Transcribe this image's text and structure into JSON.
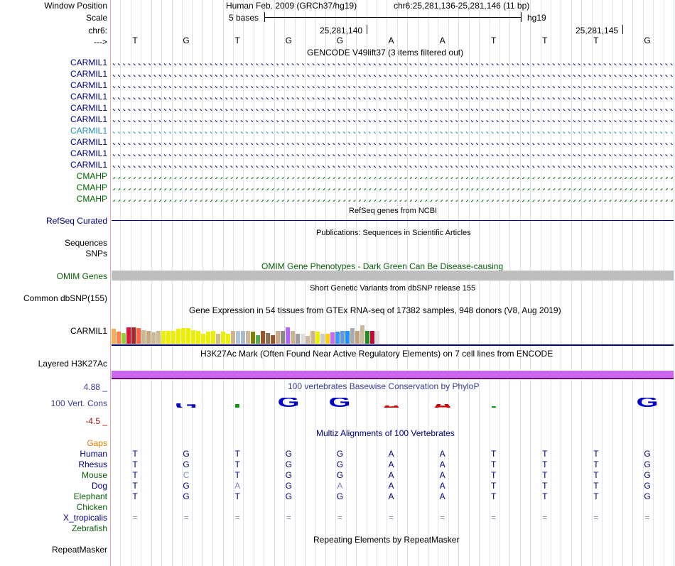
{
  "header": {
    "window_position_label": "Window Position",
    "scale_label": "Scale",
    "chrom_label": "chr6:",
    "strand_label": "--->",
    "assembly": "Human Feb. 2009 (GRCh37/hg19)",
    "position": "chr6:25,281,136-25,281,146 (11 bp)",
    "scale_text": "5 bases",
    "db": "hg19",
    "tick1": "25,281,140",
    "tick2": "25,281,145"
  },
  "sequence": [
    "T",
    "G",
    "T",
    "G",
    "G",
    "A",
    "A",
    "T",
    "T",
    "T",
    "G"
  ],
  "gencode": {
    "title": "GENCODE V49lift37 (3 items filtered out)",
    "tracks": [
      {
        "name": "CARMIL1",
        "color": "#000080",
        "dir": "right"
      },
      {
        "name": "CARMIL1",
        "color": "#000080",
        "dir": "right"
      },
      {
        "name": "CARMIL1",
        "color": "#000080",
        "dir": "right"
      },
      {
        "name": "CARMIL1",
        "color": "#000080",
        "dir": "right"
      },
      {
        "name": "CARMIL1",
        "color": "#000080",
        "dir": "right"
      },
      {
        "name": "CARMIL1",
        "color": "#000080",
        "dir": "right"
      },
      {
        "name": "CARMIL1",
        "color": "#1f8eb0",
        "dir": "right"
      },
      {
        "name": "CARMIL1",
        "color": "#000080",
        "dir": "right"
      },
      {
        "name": "CARMIL1",
        "color": "#000080",
        "dir": "right"
      },
      {
        "name": "CARMIL1",
        "color": "#000080",
        "dir": "right"
      },
      {
        "name": "CMAHP",
        "color": "#006400",
        "dir": "left"
      },
      {
        "name": "CMAHP",
        "color": "#006400",
        "dir": "left"
      },
      {
        "name": "CMAHP",
        "color": "#006400",
        "dir": "left"
      }
    ]
  },
  "refseq": {
    "title": "RefSeq genes from NCBI",
    "label": "RefSeq Curated"
  },
  "publications": {
    "title": "Publications: Sequences in Scientific Articles",
    "label1": "Sequences",
    "label2": "SNPs"
  },
  "omim": {
    "title": "OMIM Gene Phenotypes - Dark Green Can Be Disease-causing",
    "label": "OMIM Genes"
  },
  "dbsnp": {
    "title": "Short Genetic Variants from dbSNP release 155",
    "label": "Common dbSNP(155)"
  },
  "gtex": {
    "title": "Gene Expression in 54 tissues from GTEx RNA-seq of 17382 samples, 948 donors (V8, Aug 2019)",
    "label": "CARMIL1",
    "levels": [
      0.52,
      0.42,
      0.38,
      0.58,
      0.58,
      0.56,
      0.48,
      0.44,
      0.4,
      0.45,
      0.45,
      0.45,
      0.45,
      0.52,
      0.56,
      0.56,
      0.48,
      0.46,
      0.36,
      0.42,
      0.46,
      0.36,
      0.42,
      0.36,
      0.44,
      0.44,
      0.44,
      0.44,
      0.42,
      0.3,
      0.46,
      0.38,
      0.3,
      0.44,
      0.44,
      0.58,
      0.44,
      0.36,
      0.34,
      0.28,
      0.44,
      0.42,
      0.36,
      0.36,
      0.4,
      0.42,
      0.45,
      0.45,
      0.56,
      0.44,
      0.64,
      0.44,
      0.44,
      0.46
    ],
    "colors": [
      "#ffaa55",
      "#ff7f50",
      "#9acd32",
      "#dc143c",
      "#b22222",
      "#ff6347",
      "#d2b48c",
      "#c8a880",
      "#d2b48c",
      "#ccbb99",
      "#eeee00",
      "#eeee00",
      "#eeee00",
      "#eeee00",
      "#eeee00",
      "#eeee00",
      "#eeee00",
      "#eeee00",
      "#eeee00",
      "#eeee00",
      "#eeee00",
      "#ccbb99",
      "#eeee00",
      "#eeee00",
      "#d2b48c",
      "#b0c4de",
      "#aabbcc",
      "#cdb79e",
      "#808000",
      "#55aa55",
      "#a0522d",
      "#8b7355",
      "#a0522d",
      "#ccaa88",
      "#8b8b83",
      "#b266ff",
      "#cdb38b",
      "#a0a0a0",
      "#dddddd",
      "#cdb79e",
      "#d2b48c",
      "#eeee00",
      "#cccccc",
      "#ffcc00",
      "#cc66ff",
      "#3399ff",
      "#6495ed",
      "#1e90ff",
      "#aaaaaa",
      "#c0a080",
      "#ccbb99",
      "#228b22",
      "#cc0033",
      "#dddddd"
    ]
  },
  "h3k27ac": {
    "title": "H3K27Ac Mark (Often Found Near Active Regulatory Elements) on 7 cell lines from ENCODE",
    "label": "Layered H3K27Ac"
  },
  "cons": {
    "title": "100 vertebrates Basewise Conservation by PhyloP",
    "label": "100 Vert. Cons",
    "ymax": "4.88 _",
    "ymin": "-4.5 _",
    "scores": [
      0,
      0.4,
      0.3,
      0.9,
      0.9,
      0.2,
      0.3,
      0.05,
      0,
      0,
      0.9
    ]
  },
  "multiz": {
    "title": "Multiz Alignments of 100 Vertebrates",
    "gaps_label": "Gaps",
    "species": [
      {
        "name": "Human",
        "color": "#000080",
        "bases": [
          "T",
          "G",
          "T",
          "G",
          "G",
          "A",
          "A",
          "T",
          "T",
          "T",
          "G"
        ]
      },
      {
        "name": "Rhesus",
        "color": "#000080",
        "bases": [
          "T",
          "G",
          "T",
          "G",
          "G",
          "A",
          "A",
          "T",
          "T",
          "T",
          "G"
        ]
      },
      {
        "name": "Mouse",
        "color": "#0b5e0b",
        "bases": [
          "T",
          "C",
          "T",
          "G",
          "G",
          "A",
          "A",
          "T",
          "T",
          "T",
          "G"
        ]
      },
      {
        "name": "Dog",
        "color": "#000080",
        "bases": [
          "T",
          "G",
          "A",
          "G",
          "A",
          "A",
          "A",
          "T",
          "T",
          "T",
          "G"
        ]
      },
      {
        "name": "Elephant",
        "color": "#0b5e0b",
        "bases": [
          "T",
          "G",
          "T",
          "G",
          "G",
          "A",
          "A",
          "T",
          "T",
          "T",
          "G"
        ]
      },
      {
        "name": "Chicken",
        "color": "#0b5e0b",
        "bases": [
          "",
          "",
          "",
          "",
          "",
          "",
          "",
          "",
          "",
          "",
          ""
        ]
      },
      {
        "name": "X_tropicalis",
        "color": "#000080",
        "bases": [
          "=",
          "=",
          "=",
          "=",
          "=",
          "=",
          "=",
          "=",
          "=",
          "=",
          "="
        ]
      },
      {
        "name": "Zebrafish",
        "color": "#0b5e0b",
        "bases": [
          "",
          "",
          "",
          "",
          "",
          "",
          "",
          "",
          "",
          "",
          ""
        ]
      }
    ]
  },
  "repeatmasker": {
    "title": "Repeating Elements by RepeatMasker",
    "label": "RepeatMasker"
  }
}
